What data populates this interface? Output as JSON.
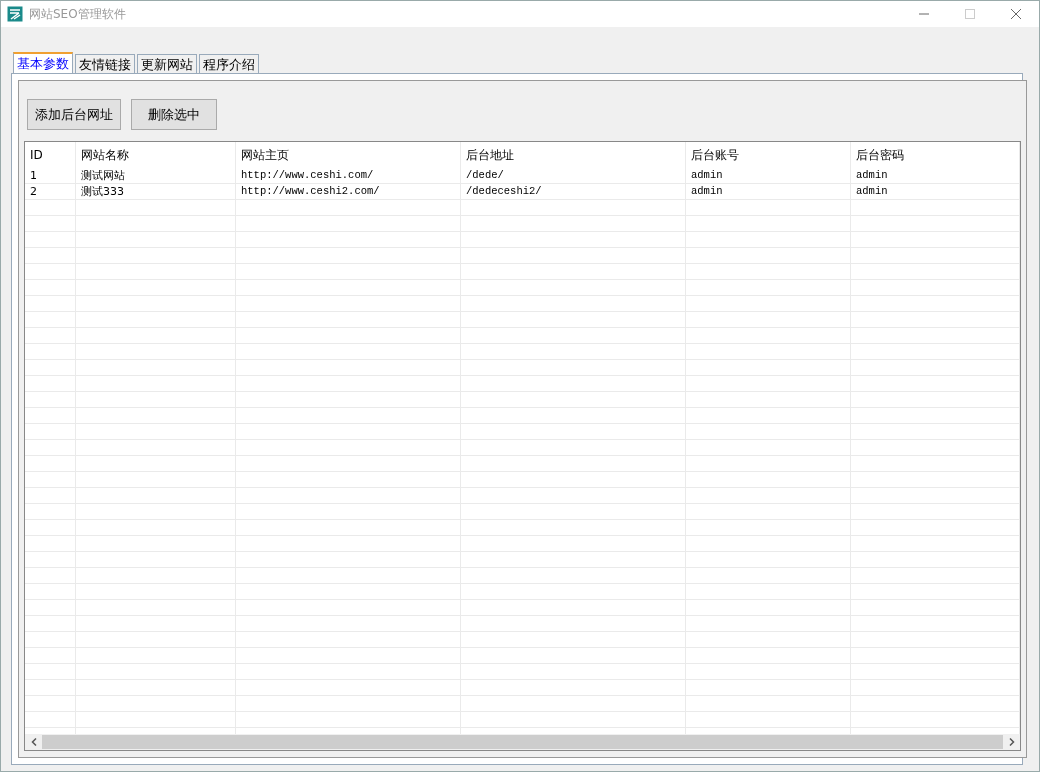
{
  "window": {
    "title": "网站SEO管理软件"
  },
  "tabs": [
    {
      "label": "基本参数",
      "selected": true
    },
    {
      "label": "友情链接",
      "selected": false
    },
    {
      "label": "更新网站",
      "selected": false
    },
    {
      "label": "程序介绍",
      "selected": false
    }
  ],
  "buttons": [
    "添加后台网址",
    "删除选中"
  ],
  "table": {
    "columns": [
      "ID",
      "网站名称",
      "网站主页",
      "后台地址",
      "后台账号",
      "后台密码"
    ],
    "rows": [
      [
        "1",
        "测试网站",
        "http://www.ceshi.com/",
        "/dede/",
        "admin",
        "admin"
      ],
      [
        "2",
        "测试333",
        "http://www.ceshi2.com/",
        "/dedeceshi2/",
        "admin",
        "admin"
      ]
    ]
  }
}
